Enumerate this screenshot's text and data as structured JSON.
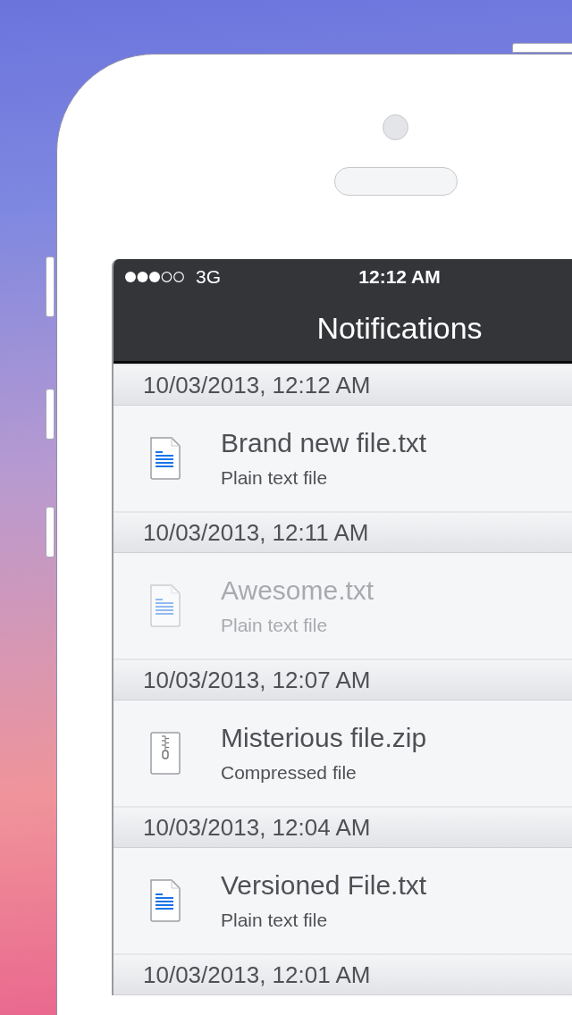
{
  "status_bar": {
    "network": "3G",
    "time": "12:12 AM"
  },
  "nav_bar": {
    "title": "Notifications"
  },
  "sections": [
    {
      "timestamp": "10/03/2013, 12:12 AM",
      "file": {
        "name": "Brand new file.txt",
        "type": "Plain text file",
        "kind": "text",
        "dimmed": false
      }
    },
    {
      "timestamp": "10/03/2013, 12:11 AM",
      "file": {
        "name": "Awesome.txt",
        "type": "Plain text file",
        "kind": "text",
        "dimmed": true
      }
    },
    {
      "timestamp": "10/03/2013, 12:07 AM",
      "file": {
        "name": "Misterious file.zip",
        "type": "Compressed file",
        "kind": "archive",
        "dimmed": false
      }
    },
    {
      "timestamp": "10/03/2013, 12:04 AM",
      "file": {
        "name": "Versioned File.txt",
        "type": "Plain text file",
        "kind": "text",
        "dimmed": false
      }
    },
    {
      "timestamp": "10/03/2013, 12:01 AM"
    }
  ]
}
